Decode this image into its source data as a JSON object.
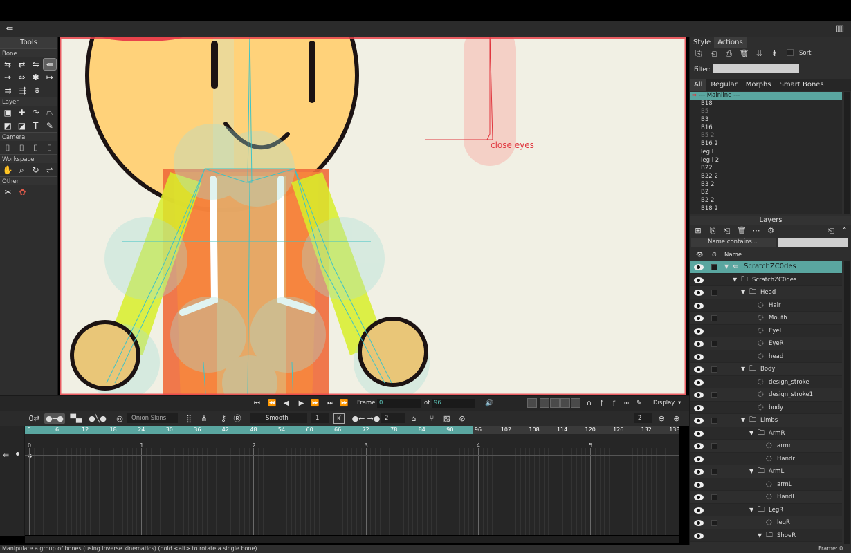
{
  "tools": {
    "title": "Tools",
    "sections": [
      "Bone",
      "Layer",
      "Camera",
      "Workspace",
      "Other"
    ]
  },
  "canvas": {
    "label": "close eyes",
    "colors": {
      "bg": "#f1f0e4",
      "border": "#e8434b",
      "skin": "#ffd27a",
      "outline": "#1c1313",
      "bone": "#3fc3c6"
    }
  },
  "style_panel": {
    "tabs": [
      "Style",
      "Actions"
    ],
    "sort_label": "Sort",
    "filter_label": "Filter:",
    "categories": [
      "All",
      "Regular",
      "Morphs",
      "Smart Bones"
    ],
    "mainline": "--- Mainline ---",
    "actions": [
      {
        "name": "B18",
        "dim": false
      },
      {
        "name": "B5",
        "dim": true
      },
      {
        "name": "B3",
        "dim": false
      },
      {
        "name": "B16",
        "dim": false
      },
      {
        "name": "B5 2",
        "dim": true
      },
      {
        "name": "B16 2",
        "dim": false
      },
      {
        "name": "leg l",
        "dim": false
      },
      {
        "name": "leg l 2",
        "dim": false
      },
      {
        "name": "B22",
        "dim": false
      },
      {
        "name": "B22 2",
        "dim": false
      },
      {
        "name": "B3 2",
        "dim": false
      },
      {
        "name": "B2",
        "dim": false
      },
      {
        "name": "B2 2",
        "dim": false
      },
      {
        "name": "B18 2",
        "dim": false
      }
    ]
  },
  "layers": {
    "title": "Layers",
    "name_filter": "Name contains...",
    "column_name": "Name",
    "rows": [
      {
        "name": "ScratchZC0des",
        "indent": 0,
        "type": "bone",
        "selected": true,
        "expanded": true,
        "sq": true
      },
      {
        "name": "ScratchZC0des",
        "indent": 1,
        "type": "group",
        "expanded": true,
        "sq": false
      },
      {
        "name": "Head",
        "indent": 2,
        "type": "group",
        "expanded": true,
        "sq": true
      },
      {
        "name": "Hair",
        "indent": 3,
        "type": "vector",
        "sq": false
      },
      {
        "name": "Mouth",
        "indent": 3,
        "type": "vector",
        "sq": true
      },
      {
        "name": "EyeL",
        "indent": 3,
        "type": "vector",
        "sq": false
      },
      {
        "name": "EyeR",
        "indent": 3,
        "type": "vector",
        "sq": true
      },
      {
        "name": "head",
        "indent": 3,
        "type": "vector",
        "sq": false
      },
      {
        "name": "Body",
        "indent": 2,
        "type": "group",
        "expanded": true,
        "sq": true
      },
      {
        "name": "design_stroke",
        "indent": 3,
        "type": "vector",
        "sq": false
      },
      {
        "name": "design_stroke1",
        "indent": 3,
        "type": "vector",
        "sq": true
      },
      {
        "name": "body",
        "indent": 3,
        "type": "vector",
        "sq": false
      },
      {
        "name": "Limbs",
        "indent": 2,
        "type": "group",
        "expanded": true,
        "sq": true
      },
      {
        "name": "ArmR",
        "indent": 3,
        "type": "group",
        "expanded": true,
        "sq": false
      },
      {
        "name": "armr",
        "indent": 4,
        "type": "vector",
        "sq": true
      },
      {
        "name": "Handr",
        "indent": 4,
        "type": "vector",
        "sq": false
      },
      {
        "name": "ArmL",
        "indent": 3,
        "type": "group",
        "expanded": true,
        "sq": true
      },
      {
        "name": "armL",
        "indent": 4,
        "type": "vector",
        "sq": false
      },
      {
        "name": "HandL",
        "indent": 4,
        "type": "vector",
        "sq": true
      },
      {
        "name": "LegR",
        "indent": 3,
        "type": "group",
        "expanded": true,
        "sq": false
      },
      {
        "name": "legR",
        "indent": 4,
        "type": "vector",
        "sq": true
      },
      {
        "name": "ShoeR",
        "indent": 4,
        "type": "group",
        "expanded": true,
        "sq": false
      }
    ]
  },
  "transport": {
    "frame_label": "Frame",
    "frame_value": "0",
    "of_label": "of",
    "total_frames": "96",
    "display_label": "Display"
  },
  "timeline_toolbar": {
    "frame_step": "0",
    "onion_skins": "Onion Skins",
    "interpolation": "Smooth",
    "interp_count": "1",
    "key_label": "K",
    "step_value": "2",
    "zoom_value": "2"
  },
  "ruler": {
    "ticks": [
      "0",
      "6",
      "12",
      "18",
      "24",
      "30",
      "36",
      "42",
      "48",
      "54",
      "60",
      "66",
      "72",
      "78",
      "84",
      "90",
      "96",
      "102",
      "108",
      "114",
      "120",
      "126",
      "132",
      "138"
    ],
    "range_end_fraction": 0.686
  },
  "timeline": {
    "second_marks": [
      "0",
      "1",
      "2",
      "3",
      "4",
      "5"
    ]
  },
  "status": {
    "message": "Manipulate a group of bones (using inverse kinematics) (hold <alt> to rotate a single bone)",
    "frame_readout": "Frame: 0"
  }
}
